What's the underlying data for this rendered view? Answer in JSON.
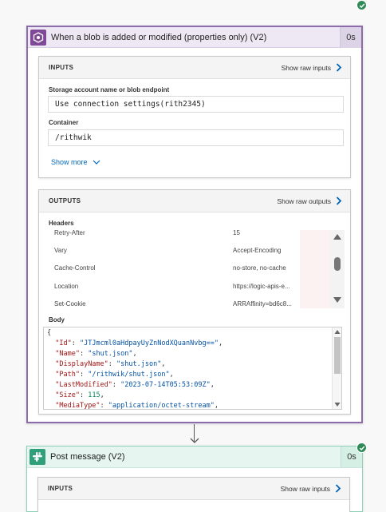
{
  "trigger": {
    "title": "When a blob is added or modified (properties only) (V2)",
    "duration": "0s",
    "status": "succeeded",
    "inputs": {
      "section_title": "INPUTS",
      "raw_label": "Show raw inputs",
      "fields": [
        {
          "label": "Storage account name or blob endpoint",
          "value": "Use connection settings(rith2345)"
        },
        {
          "label": "Container",
          "value": "/rithwik"
        }
      ],
      "show_more": "Show more"
    },
    "outputs": {
      "section_title": "OUTPUTS",
      "raw_label": "Show raw outputs",
      "headers_label": "Headers",
      "headers": [
        {
          "key": "Retry-After",
          "value": "15"
        },
        {
          "key": "Vary",
          "value": "Accept-Encoding"
        },
        {
          "key": "Cache-Control",
          "value": "no-store, no-cache"
        },
        {
          "key": "Location",
          "value": "https://logic-apis-e..."
        },
        {
          "key": "Set-Cookie",
          "value": "ARRAffinity=bd6c8..."
        }
      ],
      "body_label": "Body",
      "body_open": "{",
      "body": [
        {
          "key": "\"Id\"",
          "value": "\"JTJmcml0aHdpayUyZnNodXQuanNvbg==\"",
          "type": "str"
        },
        {
          "key": "\"Name\"",
          "value": "\"shut.json\"",
          "type": "str"
        },
        {
          "key": "\"DisplayName\"",
          "value": "\"shut.json\"",
          "type": "str"
        },
        {
          "key": "\"Path\"",
          "value": "\"/rithwik/shut.json\"",
          "type": "str"
        },
        {
          "key": "\"LastModified\"",
          "value": "\"2023-07-14T05:53:09Z\"",
          "type": "str"
        },
        {
          "key": "\"Size\"",
          "value": "115",
          "type": "num"
        },
        {
          "key": "\"MediaType\"",
          "value": "\"application/octet-stream\"",
          "type": "str"
        }
      ]
    }
  },
  "action": {
    "title": "Post message (V2)",
    "duration": "0s",
    "status": "succeeded",
    "inputs": {
      "section_title": "INPUTS",
      "raw_label": "Show raw inputs"
    }
  },
  "colors": {
    "trigger_accent": "#804998",
    "action_accent": "#2fa07a",
    "success": "#2e8b57",
    "link": "#0066b8"
  }
}
